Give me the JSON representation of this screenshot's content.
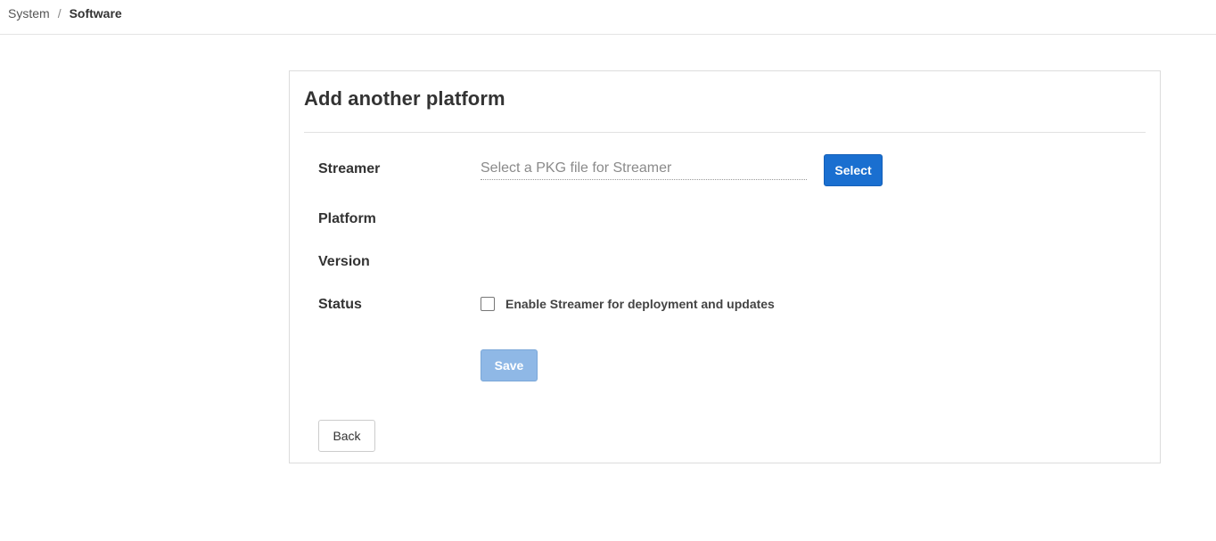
{
  "breadcrumb": {
    "parent": "System",
    "separator": "/",
    "current": "Software"
  },
  "panel": {
    "title": "Add another platform"
  },
  "form": {
    "streamer_label": "Streamer",
    "streamer_input_value": "",
    "streamer_input_placeholder": "Select a PKG file for Streamer",
    "select_button": "Select",
    "platform_label": "Platform",
    "platform_value": "",
    "version_label": "Version",
    "version_value": "",
    "status_label": "Status",
    "status_checkbox_label": "Enable Streamer for deployment and updates",
    "status_checked": false,
    "save_button": "Save",
    "back_button": "Back"
  },
  "colors": {
    "primary": "#1a6fd0",
    "primary_disabled": "#8fb8e6",
    "border": "#dcdcdc"
  }
}
